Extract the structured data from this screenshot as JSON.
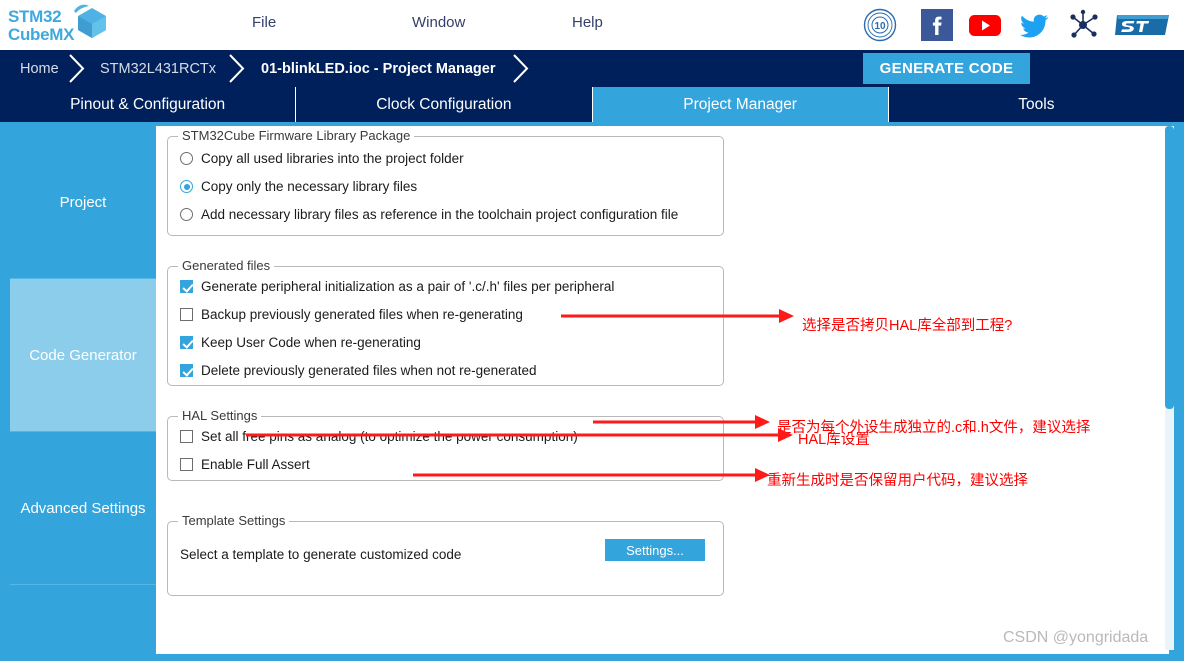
{
  "app": {
    "logo_line1": "STM32",
    "logo_line2": "CubeMX",
    "watermark": "CSDN @yongridada"
  },
  "menu": {
    "items": [
      {
        "label": "File",
        "name": "menu-file"
      },
      {
        "label": "Window",
        "name": "menu-window"
      },
      {
        "label": "Help",
        "name": "menu-help"
      }
    ]
  },
  "social_icons": [
    {
      "name": "ten-years-badge-icon",
      "label": "10"
    },
    {
      "name": "facebook-icon",
      "label": "f"
    },
    {
      "name": "youtube-icon",
      "label": "play"
    },
    {
      "name": "twitter-icon",
      "label": "bird"
    },
    {
      "name": "community-network-icon",
      "label": "network"
    },
    {
      "name": "st-logo-icon",
      "label": "ST"
    }
  ],
  "breadcrumb": {
    "items": [
      {
        "label": "Home",
        "active": false
      },
      {
        "label": "STM32L431RCTx",
        "active": false
      },
      {
        "label": "01-blinkLED.ioc - Project Manager",
        "active": true
      }
    ]
  },
  "generate_code_button": {
    "label": "GENERATE CODE"
  },
  "tabs": [
    {
      "label": "Pinout & Configuration",
      "active": false
    },
    {
      "label": "Clock Configuration",
      "active": false
    },
    {
      "label": "Project Manager",
      "active": true
    },
    {
      "label": "Tools",
      "active": false
    }
  ],
  "sidebar": {
    "items": [
      {
        "label": "Project",
        "selected": false
      },
      {
        "label": "Code Generator",
        "selected": true
      },
      {
        "label": "Advanced Settings",
        "selected": false
      }
    ]
  },
  "groups": {
    "firmware": {
      "title": "STM32Cube Firmware Library Package",
      "options": [
        {
          "label": "Copy all used libraries into the project folder",
          "checked": false
        },
        {
          "label": "Copy only the necessary library files",
          "checked": true
        },
        {
          "label": "Add necessary library files as reference in the toolchain project configuration file",
          "checked": false
        }
      ]
    },
    "generated_files": {
      "title": "Generated files",
      "options": [
        {
          "label": "Generate peripheral initialization as a pair of '.c/.h' files per peripheral",
          "checked": true
        },
        {
          "label": "Backup previously generated files when re-generating",
          "checked": false
        },
        {
          "label": "Keep User Code when re-generating",
          "checked": true
        },
        {
          "label": "Delete previously generated files when not re-generated",
          "checked": true
        }
      ]
    },
    "hal_settings": {
      "title": "HAL Settings",
      "options": [
        {
          "label": "Set all free pins as analog (to optimize the power consumption)",
          "checked": false
        },
        {
          "label": "Enable Full Assert",
          "checked": false
        }
      ]
    },
    "template_settings": {
      "title": "Template Settings",
      "description": "Select a template to generate customized code",
      "button_label": "Settings..."
    }
  },
  "annotations": [
    {
      "text": "选择是否拷贝HAL库全部到工程?"
    },
    {
      "text": "是否为每个外设生成独立的.c和.h文件，建议选择"
    },
    {
      "text": "重新生成时是否保留用户代码，建议选择"
    },
    {
      "text": "HAL库设置"
    }
  ],
  "colors": {
    "brand_blue": "#34a4dc",
    "navy": "#00205c",
    "sidebar_selected": "#8ccdec",
    "annotation_red": "#ff0000"
  }
}
